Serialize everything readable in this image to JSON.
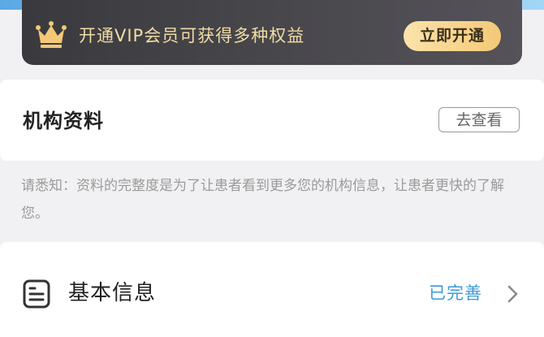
{
  "vip_banner": {
    "text": "开通VIP会员可获得多种权益",
    "button_label": "立即开通",
    "icon": "crown-icon",
    "accent_color": "#f3c977"
  },
  "org_profile": {
    "title": "机构资料",
    "view_button_label": "去查看"
  },
  "notice": {
    "text": "请悉知：资料的完整度是为了让患者看到更多您的机构信息，让患者更快的了解您。"
  },
  "basic_info": {
    "title": "基本信息",
    "status": "已完善",
    "icon": "document-icon",
    "status_color": "#3b9ad9"
  }
}
